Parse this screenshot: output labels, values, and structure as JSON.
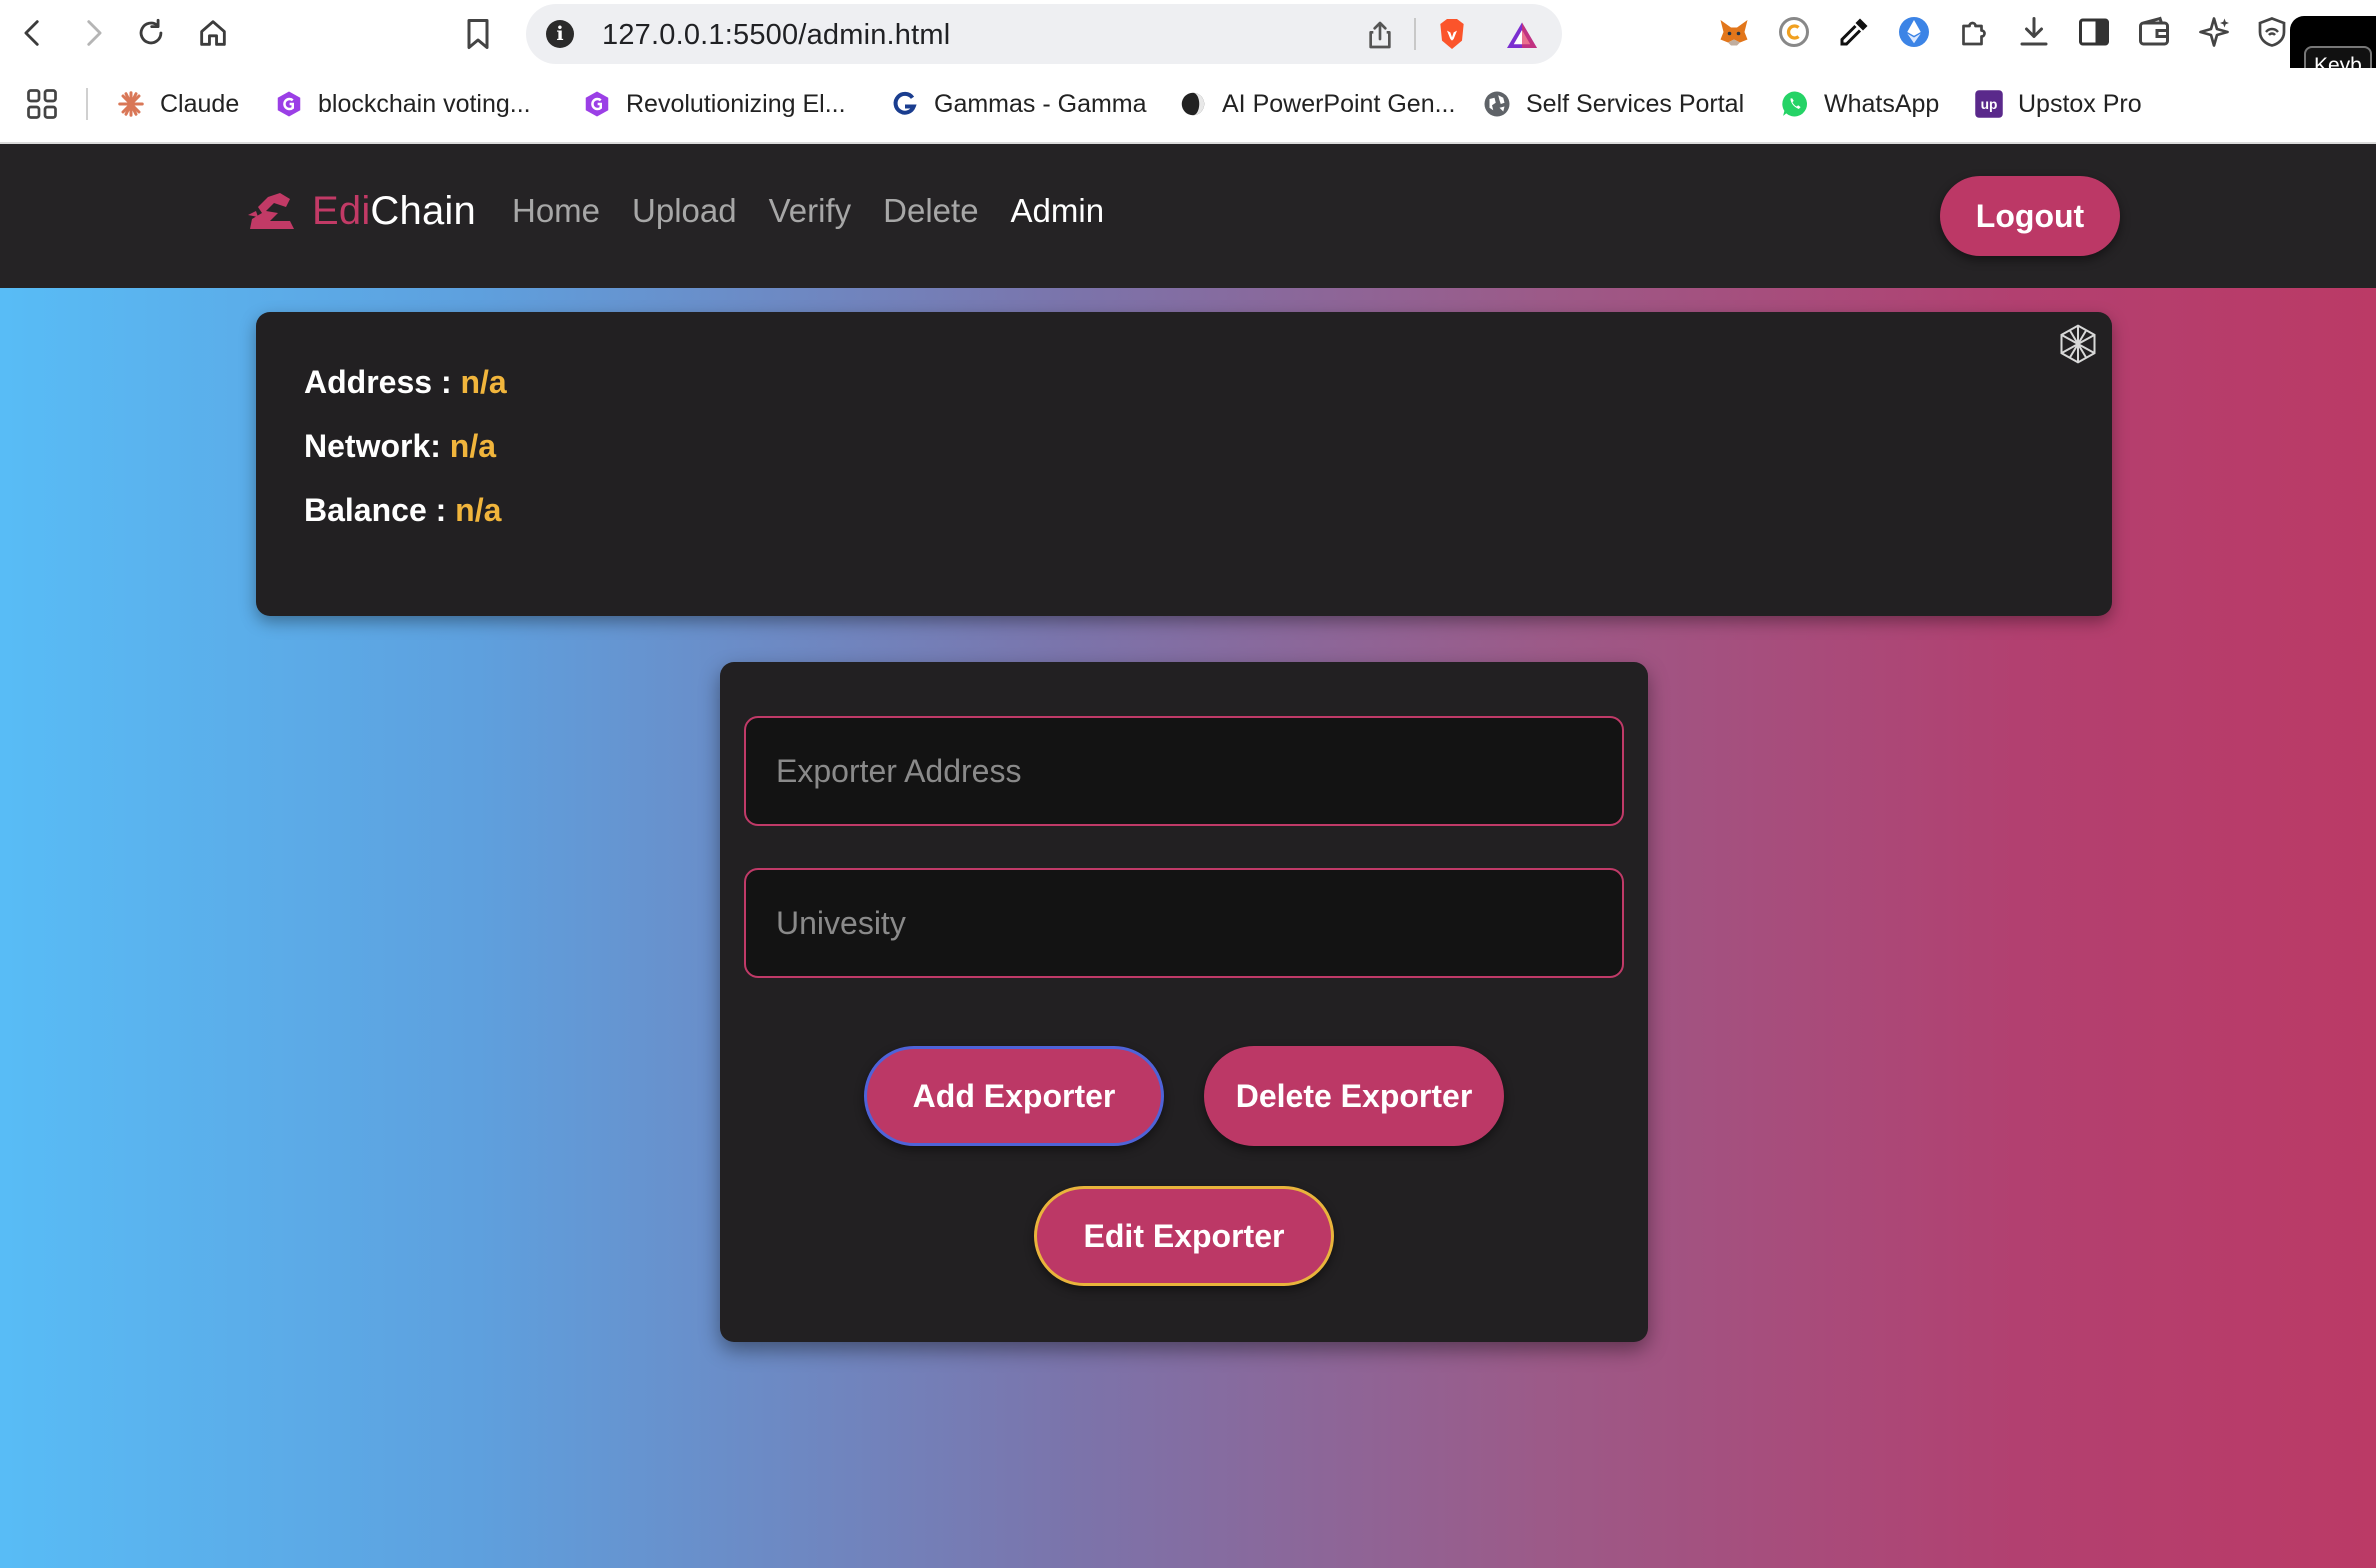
{
  "browser": {
    "url": "127.0.0.1:5500/admin.html",
    "keyboard_popup_text": "Keyb",
    "bookmarks": [
      {
        "label": "Claude",
        "icon": "claude-icon"
      },
      {
        "label": "blockchain voting...",
        "icon": "gamma-icon"
      },
      {
        "label": "Revolutionizing El...",
        "icon": "gamma-icon"
      },
      {
        "label": "Gammas - Gamma",
        "icon": "g-icon"
      },
      {
        "label": "AI PowerPoint Gen...",
        "icon": "sphere-icon"
      },
      {
        "label": "Self Services Portal",
        "icon": "globe-icon"
      },
      {
        "label": "WhatsApp",
        "icon": "whatsapp-icon"
      },
      {
        "label": "Upstox Pro",
        "icon": "upstox-icon"
      }
    ],
    "colors": {
      "brave": "#fb542b",
      "whatsapp": "#25d366",
      "upstox": "#5a298b"
    }
  },
  "site": {
    "brand_part1": "Edi",
    "brand_part2": "Chain",
    "nav": [
      {
        "label": "Home",
        "active": false
      },
      {
        "label": "Upload",
        "active": false
      },
      {
        "label": "Verify",
        "active": false
      },
      {
        "label": "Delete",
        "active": false
      },
      {
        "label": "Admin",
        "active": true
      }
    ],
    "logout_label": "Logout",
    "colors": {
      "accent": "#bc3866",
      "value": "#f1b53c",
      "card": "#222022"
    }
  },
  "wallet": {
    "address_label": "Address :",
    "address_value": "n/a",
    "network_label": "Network:",
    "network_value": "n/a",
    "balance_label": "Balance :",
    "balance_value": "n/a"
  },
  "form": {
    "exporter_address_placeholder": "Exporter Address",
    "university_placeholder": "Univesity",
    "add_label": "Add Exporter",
    "delete_label": "Delete Exporter",
    "edit_label": "Edit Exporter"
  }
}
